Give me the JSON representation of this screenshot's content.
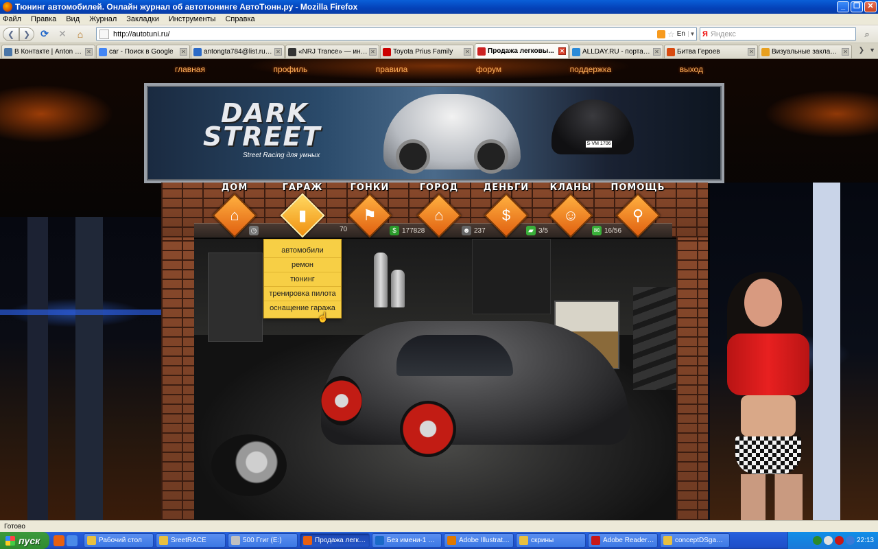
{
  "window": {
    "title": "Тюнинг автомобилей. Онлайн журнал об автотюнинге АвтоТюнн.ру - Mozilla Firefox"
  },
  "menu": [
    "Файл",
    "Правка",
    "Вид",
    "Журнал",
    "Закладки",
    "Инструменты",
    "Справка"
  ],
  "address": {
    "url": "http://autotuni.ru/",
    "lang": "En"
  },
  "search": {
    "placeholder": "Яндекс",
    "engine_logo": "Я"
  },
  "tabs": [
    {
      "label": "В Контакте | Anton Kra...",
      "color": "#4a76a8"
    },
    {
      "label": "car - Поиск в Google",
      "color": "#4285f4"
    },
    {
      "label": "antongta784@list.ru: 11...",
      "color": "#2a6ac8"
    },
    {
      "label": "«NRJ Trance» — интер...",
      "color": "#333333"
    },
    {
      "label": "Toyota Prius Family",
      "color": "#cc0000"
    },
    {
      "label": "Продажа легковы...",
      "color": "#cc2222",
      "active": true
    },
    {
      "label": "ALLDAY.RU - портал об...",
      "color": "#2a8ad8"
    },
    {
      "label": "Битва Героев",
      "color": "#d84a10"
    },
    {
      "label": "Визуальные закладки",
      "color": "#e8a020"
    }
  ],
  "site": {
    "top_nav": [
      "главная",
      "профиль",
      "правила",
      "форум",
      "поддержка",
      "выход"
    ],
    "logo": {
      "line1": "DARK",
      "line2": "STREET",
      "slogan": "Street Racing для умных"
    },
    "plate": "S·VM 1706",
    "game_nav": [
      {
        "label": "ДОМ",
        "icon": "house-icon"
      },
      {
        "label": "ГАРАЖ",
        "icon": "garage-icon",
        "active": true
      },
      {
        "label": "ГОНКИ",
        "icon": "checkered-flags-icon"
      },
      {
        "label": "ГОРОД",
        "icon": "city-icon"
      },
      {
        "label": "ДЕНЬГИ",
        "icon": "dollar-icon"
      },
      {
        "label": "КЛАНЫ",
        "icon": "user-icon"
      },
      {
        "label": "ПОМОЩЬ",
        "icon": "magnifier-icon"
      }
    ],
    "stats": {
      "partial": "70",
      "money": "177828",
      "rating": "237",
      "cars": "3/5",
      "messages": "16/56"
    },
    "garage_menu": [
      "автомобили",
      "ремон",
      "тюнинг",
      "тренировка пилота",
      "оснащение гаража"
    ]
  },
  "status": {
    "text": "Готово"
  },
  "taskbar": {
    "start": "пуск",
    "tasks": [
      {
        "label": "Рабочий стол",
        "color": "#e8c040"
      },
      {
        "label": "SreetRACE",
        "color": "#e8c040"
      },
      {
        "label": "500 Ггиг (E:)",
        "color": "#c0c0c0"
      },
      {
        "label": "Продажа легков...",
        "color": "#e86010",
        "active": true
      },
      {
        "label": "Без имени-1 @ 6...",
        "color": "#1a6ac8"
      },
      {
        "label": "Adobe Illustrator ...",
        "color": "#e07800"
      },
      {
        "label": "скрины",
        "color": "#e8c040"
      },
      {
        "label": "Adobe Reader Up...",
        "color": "#c81818"
      },
      {
        "label": "conceptDSgame...",
        "color": "#e8c040"
      }
    ],
    "clock": "22:13"
  }
}
